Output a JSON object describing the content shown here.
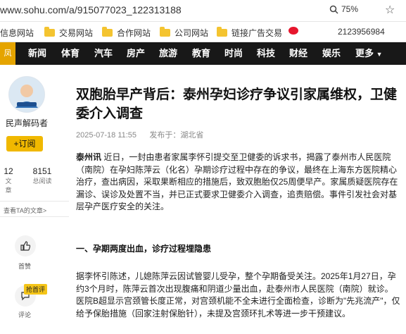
{
  "browser": {
    "url_host": "www.sohu.com",
    "url_path": "/a/915077023_122313188",
    "zoom": "75%"
  },
  "bookmarks": [
    {
      "label": "信息网站",
      "icon": "none"
    },
    {
      "label": "交易网站",
      "icon": "folder-icon"
    },
    {
      "label": "合作网站",
      "icon": "folder-icon"
    },
    {
      "label": "公司网站",
      "icon": "folder-icon"
    },
    {
      "label": "链接广告交易",
      "icon": "folder-icon"
    },
    {
      "label": "2123956984",
      "icon": "weibo-icon"
    }
  ],
  "nav": {
    "logo": "凤",
    "items": [
      "新闻",
      "体育",
      "汽车",
      "房产",
      "旅游",
      "教育",
      "时尚",
      "科技",
      "财经",
      "娱乐",
      "更多"
    ]
  },
  "sidebar": {
    "author": "民声解码者",
    "follow_label": "+订阅",
    "stats": [
      {
        "num": "12",
        "label": "文章"
      },
      {
        "num": "8151",
        "label": "总阅读"
      }
    ],
    "see_all": "查看TA的文章>",
    "actions": [
      {
        "label": "首赞",
        "icon": "thumb-up-icon"
      },
      {
        "label": "评论",
        "icon": "comment-icon",
        "badge": "抢首评"
      }
    ]
  },
  "article": {
    "title": "双胞胎早产背后：泰州孕妇诊疗争议引家属维权，卫健委介入调查",
    "date": "2025-07-18 11:55",
    "published_in_label": "发布于：",
    "published_in": "湖北省",
    "para1_lead": "泰州讯",
    "para1": " 近日，一封由患者家属李怀引提交至卫健委的诉求书，揭露了泰州市人民医院（南院）在孕妇陈萍云（化名）孕期诊疗过程中存在的争议，最终在上海东方医院精心治疗，查出病因，采取果断相应的措施后，致双胞胎仅25周便早产。家属质疑医院存在漏诊、误诊及处置不当，并已正式要求卫健委介入调查，追责赔偿。事件引发社会对基层孕产医疗安全的关注。",
    "section1": "一、孕期两度出血，诊疗过程埋隐患",
    "para2": "据李怀引陈述，儿媳陈萍云因试管婴儿受孕，整个孕期备受关注。2025年1月27日，孕约3个月时，陈萍云首次出现腹痛和阴道少量出血，赴泰州市人民医院（南院）就诊。医院B超显示宫颈管长度正常，对宫颈机能不全未进行全面检查，诊断为\"先兆流产\"，仅给予保胎措施（回家注射保胎针），未提及宫颈环扎术等进一步干预建议。"
  },
  "colors": {
    "nav_bg": "#181818",
    "accent": "#f0b800"
  }
}
